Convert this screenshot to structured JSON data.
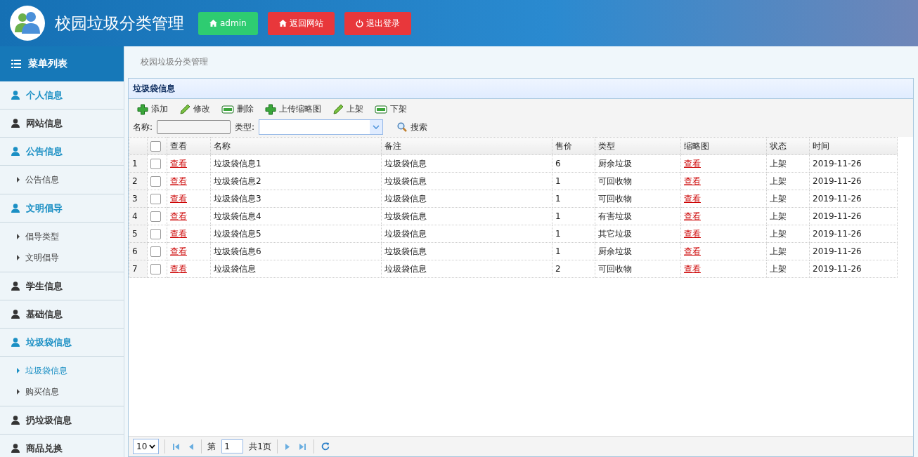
{
  "header": {
    "title": "校园垃圾分类管理",
    "buttons": [
      {
        "label": "admin",
        "kind": "user"
      },
      {
        "label": "返回网站",
        "kind": "home"
      },
      {
        "label": "退出登录",
        "kind": "logout"
      }
    ]
  },
  "sidebar": {
    "title": "菜单列表",
    "items": [
      {
        "label": "个人信息",
        "expanded": true
      },
      {
        "label": "网站信息",
        "expanded": false
      },
      {
        "label": "公告信息",
        "expanded": true,
        "children": [
          {
            "label": "公告信息",
            "selected": false
          }
        ]
      },
      {
        "label": "文明倡导",
        "expanded": true,
        "children": [
          {
            "label": "倡导类型",
            "selected": false
          },
          {
            "label": "文明倡导",
            "selected": false
          }
        ]
      },
      {
        "label": "学生信息",
        "expanded": false
      },
      {
        "label": "基础信息",
        "expanded": false
      },
      {
        "label": "垃圾袋信息",
        "expanded": true,
        "children": [
          {
            "label": "垃圾袋信息",
            "selected": true
          },
          {
            "label": "购买信息",
            "selected": false
          }
        ]
      },
      {
        "label": "扔垃圾信息",
        "expanded": false
      },
      {
        "label": "商品兑换",
        "expanded": false
      }
    ]
  },
  "breadcrumb": "校园垃圾分类管理",
  "panel": {
    "title": "垃圾袋信息",
    "toolbar": [
      {
        "label": "添加",
        "kind": "add"
      },
      {
        "label": "修改",
        "kind": "edit"
      },
      {
        "label": "删除",
        "kind": "remove"
      },
      {
        "label": "上传缩略图",
        "kind": "add"
      },
      {
        "label": "上架",
        "kind": "edit"
      },
      {
        "label": "下架",
        "kind": "remove"
      }
    ],
    "filters": {
      "name_label": "名称:",
      "type_label": "类型:",
      "search": "搜索"
    },
    "table": {
      "all_checked": false,
      "columns": [
        "查看",
        "名称",
        "备注",
        "售价",
        "类型",
        "缩略图",
        "状态",
        "时间"
      ],
      "rows": [
        {
          "num": "1",
          "checked": false,
          "view": "查看",
          "name": "垃圾袋信息1",
          "note": "垃圾袋信息",
          "price": "6",
          "type": "厨余垃圾",
          "thumb": "查看",
          "status": "上架",
          "time": "2019-11-26"
        },
        {
          "num": "2",
          "checked": false,
          "view": "查看",
          "name": "垃圾袋信息2",
          "note": "垃圾袋信息",
          "price": "1",
          "type": "可回收物",
          "thumb": "查看",
          "status": "上架",
          "time": "2019-11-26"
        },
        {
          "num": "3",
          "checked": false,
          "view": "查看",
          "name": "垃圾袋信息3",
          "note": "垃圾袋信息",
          "price": "1",
          "type": "可回收物",
          "thumb": "查看",
          "status": "上架",
          "time": "2019-11-26"
        },
        {
          "num": "4",
          "checked": false,
          "view": "查看",
          "name": "垃圾袋信息4",
          "note": "垃圾袋信息",
          "price": "1",
          "type": "有害垃圾",
          "thumb": "查看",
          "status": "上架",
          "time": "2019-11-26"
        },
        {
          "num": "5",
          "checked": false,
          "view": "查看",
          "name": "垃圾袋信息5",
          "note": "垃圾袋信息",
          "price": "1",
          "type": "其它垃圾",
          "thumb": "查看",
          "status": "上架",
          "time": "2019-11-26"
        },
        {
          "num": "6",
          "checked": false,
          "view": "查看",
          "name": "垃圾袋信息6",
          "note": "垃圾袋信息",
          "price": "1",
          "type": "厨余垃圾",
          "thumb": "查看",
          "status": "上架",
          "time": "2019-11-26"
        },
        {
          "num": "7",
          "checked": false,
          "view": "查看",
          "name": "垃圾袋信息",
          "note": "垃圾袋信息",
          "price": "2",
          "type": "可回收物",
          "thumb": "查看",
          "status": "上架",
          "time": "2019-11-26"
        }
      ]
    },
    "pager": {
      "page_size": "10",
      "page_prefix": "第",
      "page": "1",
      "page_total": "共1页"
    }
  }
}
